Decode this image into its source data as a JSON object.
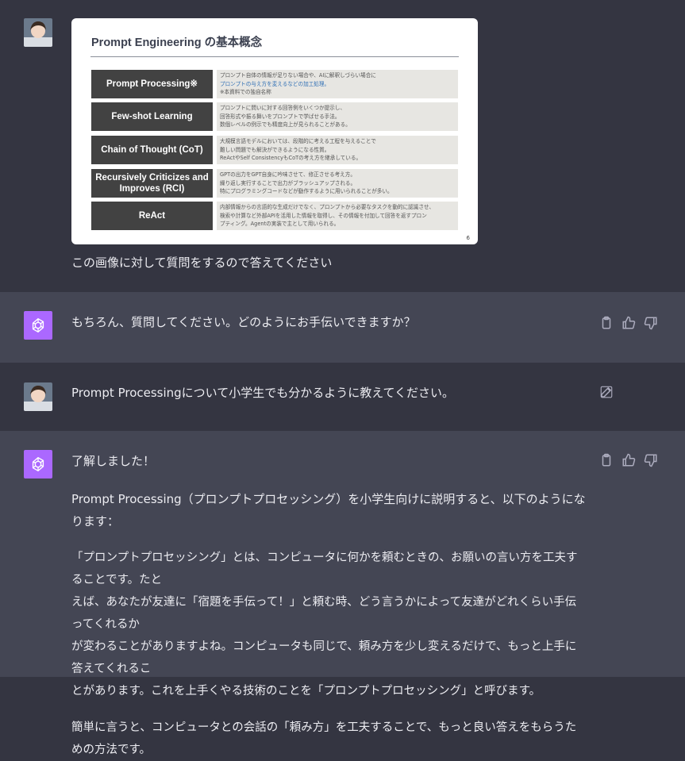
{
  "colors": {
    "page_bg": "#343541",
    "assistant_bg": "#444654",
    "bot_avatar": "#ab68ff",
    "text": "#ececf1",
    "icon": "#acacbe"
  },
  "messages": {
    "m1": {
      "role": "user",
      "text": "この画像に対して質問をするので答えてください",
      "image": {
        "title": "Prompt Engineering の基本概念",
        "rows": [
          {
            "label": "Prompt Processing※",
            "desc": [
              "プロンプト自体の情報が足りない場合や、AIに解釈しづらい場合に",
              "プロンプトの与え方を変えるなどの加工処理。",
              "※本資料での独自名称"
            ]
          },
          {
            "label": "Few-shot Learning",
            "desc": [
              "プロンプトに問いに対する回答例をいくつか提示し、",
              "回答形式や振る舞いをプロンプトで学ばせる手法。",
              "数個レベルの例示でも精度向上が見られることがある。"
            ]
          },
          {
            "label": "Chain of Thought (CoT)",
            "desc": [
              "大規模言語モデルにおいては、段階的に考える工程を与えることで",
              "難しい問題でも解決ができるようになる性質。",
              "ReActやSelf ConsistencyもCoTの考え方を継承している。"
            ]
          },
          {
            "label": "Recursively Criticizes and Improves (RCI)",
            "desc": [
              "GPTの出力をGPT自身に吟味させて、修正させる考え方。",
              "繰り返し実行することで出力がブラッシュアップされる。",
              "特にプログラミングコードなどが動作するように用いられることが多い。"
            ]
          },
          {
            "label": "ReAct",
            "desc": [
              "内部情報からの言語的な生成だけでなく、プロンプトから必要なタスクを動的に認識させ、",
              "検索や計算など外部APIを活用した情報を取得し、その情報を付加して回答を返すプロン",
              "プティング。Agentの実装で主として用いられる。"
            ]
          }
        ],
        "page_number": "6"
      }
    },
    "m2": {
      "role": "assistant",
      "text": "もちろん、質問してください。どのようにお手伝いできますか？"
    },
    "m3": {
      "role": "user",
      "text": "Prompt Processingについて小学生でも分かるように教えてください。"
    },
    "m4": {
      "role": "assistant",
      "p1": "了解しました！",
      "p2": "Prompt Processing（プロンプトプロセッシング）を小学生向けに説明すると、以下のようになります：",
      "p3_lines": [
        "「プロンプトプロセッシング」とは、コンピュータに何かを頼むときの、お願いの言い方を工夫することです。たと",
        "えば、あなたが友達に「宿題を手伝って！」と頼む時、どう言うかによって友達がどれくらい手伝ってくれるか",
        "が変わることがありますよね。コンピュータも同じで、頼み方を少し変えるだけで、もっと上手に答えてくれるこ",
        "とがあります。これを上手くやる技術のことを「プロンプトプロセッシング」と呼びます。"
      ],
      "p4": "簡単に言うと、コンピュータとの会話の「頼み方」を工夫することで、もっと良い答えをもらうための方法です。"
    }
  },
  "icons": {
    "copy": "clipboard-icon",
    "like": "thumbs-up-icon",
    "dislike": "thumbs-down-icon",
    "edit": "edit-icon",
    "bot": "openai-logo-icon"
  }
}
